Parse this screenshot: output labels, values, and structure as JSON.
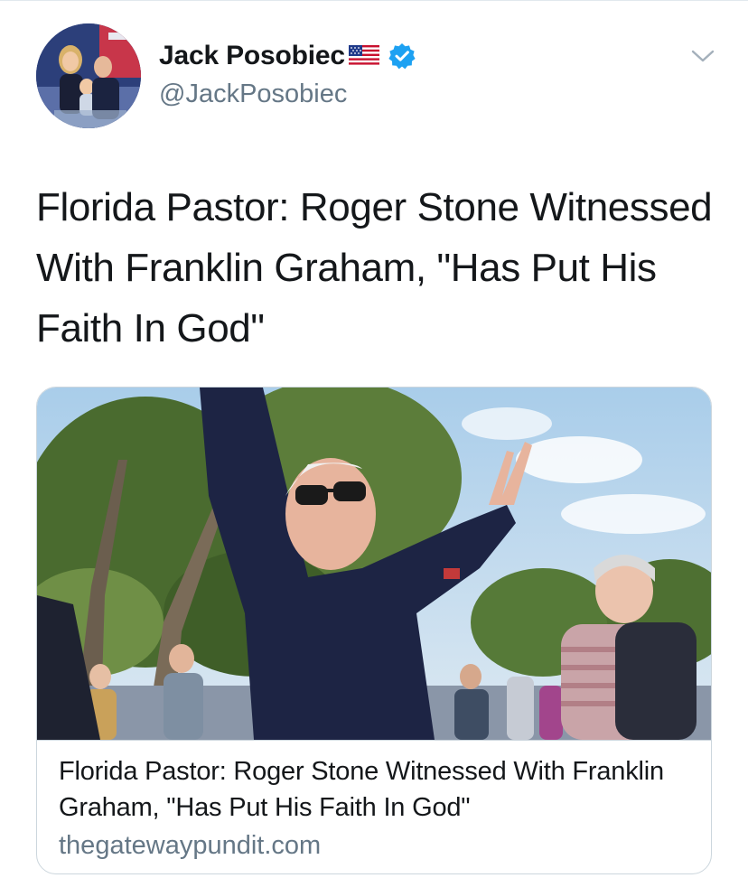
{
  "tweet": {
    "author": {
      "display_name": "Jack Posobiec",
      "handle": "@JackPosobiec",
      "verified": true,
      "flag_icon": "us-flag-icon"
    },
    "text": "Florida Pastor: Roger Stone Witnessed With Franklin Graham, \"Has Put His Faith In God\"",
    "menu_icon": "chevron-down-icon"
  },
  "card": {
    "title": "Florida Pastor: Roger Stone Witnessed With Franklin Graham, \"Has Put His Faith In God\"",
    "domain": "thegatewaypundit.com"
  },
  "colors": {
    "text_primary": "#14171a",
    "text_secondary": "#657786",
    "verified_blue": "#1da1f2",
    "border": "#ccd6dd"
  }
}
